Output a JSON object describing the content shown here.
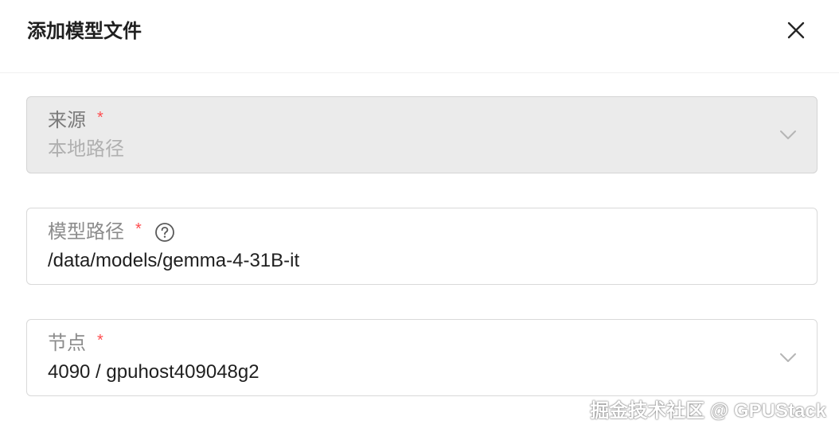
{
  "modal": {
    "title": "添加模型文件",
    "close_icon": "close-icon"
  },
  "fields": {
    "source": {
      "label": "来源",
      "required": "*",
      "value": "本地路径",
      "disabled": true,
      "icon": "chevron-down-icon"
    },
    "model_path": {
      "label": "模型路径",
      "required": "*",
      "help_icon": "question-circle-icon",
      "value": "/data/models/gemma-4-31B-it"
    },
    "node": {
      "label": "节点",
      "required": "*",
      "value": "4090 / gpuhost409048g2",
      "icon": "chevron-down-icon"
    }
  },
  "watermark": {
    "text": "掘金技术社区 @ GPUStack"
  },
  "colors": {
    "required": "#ff4d4f",
    "disabled_bg": "#ebebeb",
    "border": "#d9d9d9"
  }
}
